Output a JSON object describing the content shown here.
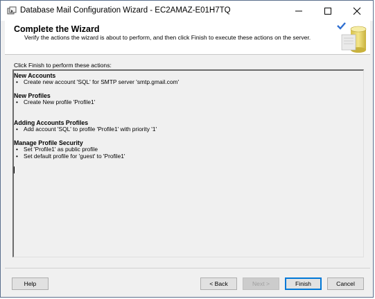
{
  "window": {
    "title": "Database Mail Configuration Wizard - EC2AMAZ-E01H7TQ",
    "icon": "app-wizard-icon"
  },
  "header": {
    "title": "Complete the Wizard",
    "subtitle": "Verify the actions the wizard is about to perform, and then click Finish to execute these actions on the server.",
    "art_icon": "checkmark-database-icon"
  },
  "main": {
    "instruction": "Click Finish to perform these actions:",
    "sections": [
      {
        "title": "New Accounts",
        "items": [
          "Create new account 'SQL' for SMTP server 'smtp.gmail.com'"
        ]
      },
      {
        "title": "New Profiles",
        "items": [
          "Create New profile 'Profile1'"
        ]
      },
      {
        "title": "Adding Accounts Profiles",
        "items": [
          "Add account 'SQL' to profile 'Profile1' with priority '1'"
        ]
      },
      {
        "title": "Manage Profile Security",
        "items": [
          "Set 'Profile1' as public profile",
          "Set default profile for 'guest' to 'Profile1'"
        ]
      }
    ]
  },
  "footer": {
    "help": "Help",
    "back": "< Back",
    "next": "Next >",
    "finish": "Finish",
    "cancel": "Cancel"
  },
  "colors": {
    "accent": "#0078d7",
    "window_bg": "#f0f0f0",
    "header_bg": "#ffffff"
  }
}
